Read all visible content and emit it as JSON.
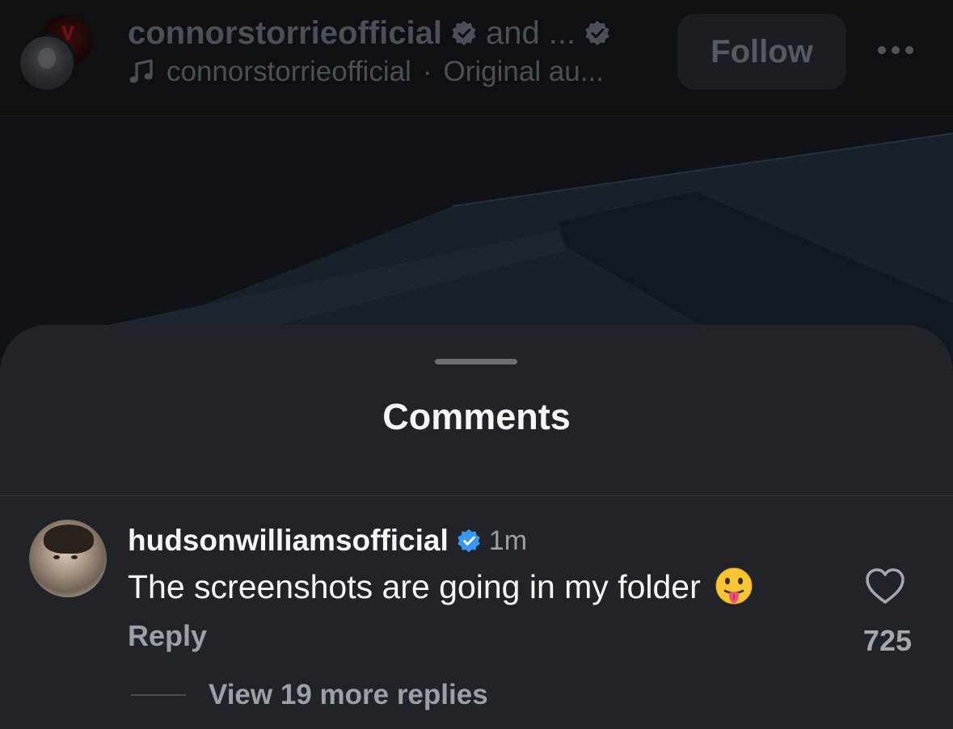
{
  "header": {
    "username": "connorstorrieofficial",
    "and_more": "and ...",
    "audio_owner": "connorstorrieofficial",
    "audio_separator": "·",
    "audio_title": "Original au...",
    "follow_label": "Follow",
    "more_icon": "more-horizontal-icon"
  },
  "sheet": {
    "title": "Comments"
  },
  "comments": [
    {
      "username": "hudsonwilliamsofficial",
      "verified": true,
      "time": "1m",
      "text": "The screenshots are going in my folder",
      "emoji": "face-with-tongue-icon",
      "reply_label": "Reply",
      "likes": "725",
      "view_replies": "View 19 more replies"
    }
  ],
  "colors": {
    "sheet_bg": "#212328",
    "verified_blue": "#3897f0",
    "text_primary": "#f4f5f6",
    "text_secondary": "#9aa0a8"
  }
}
